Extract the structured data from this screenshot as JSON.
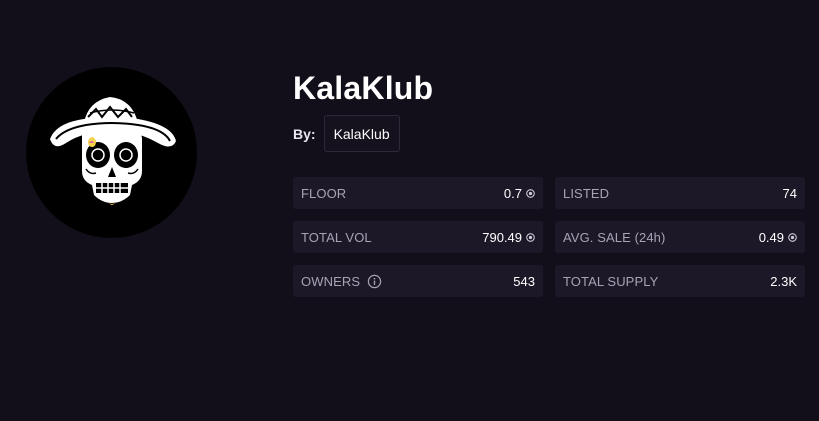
{
  "collection": {
    "name": "KalaKlub",
    "avatar_icon": "sugar-skull-sombrero-icon",
    "by_label": "By:",
    "creator": "KalaKlub"
  },
  "stats": {
    "floor": {
      "label": "FLOOR",
      "value": "0.7",
      "currency_icon": "sol-coin-icon"
    },
    "listed": {
      "label": "LISTED",
      "value": "74"
    },
    "total_vol": {
      "label": "TOTAL VOL",
      "value": "790.49",
      "currency_icon": "sol-coin-icon"
    },
    "avg_sale": {
      "label": "AVG. SALE (24h)",
      "value": "0.49",
      "currency_icon": "sol-coin-icon"
    },
    "owners": {
      "label": "OWNERS",
      "value": "543",
      "info_icon": "info-icon"
    },
    "total_supply": {
      "label": "TOTAL SUPPLY",
      "value": "2.3K"
    }
  },
  "colors": {
    "background": "#130f1a",
    "card": "#1d1827",
    "label": "#a8a2b5",
    "value": "#ffffff"
  }
}
